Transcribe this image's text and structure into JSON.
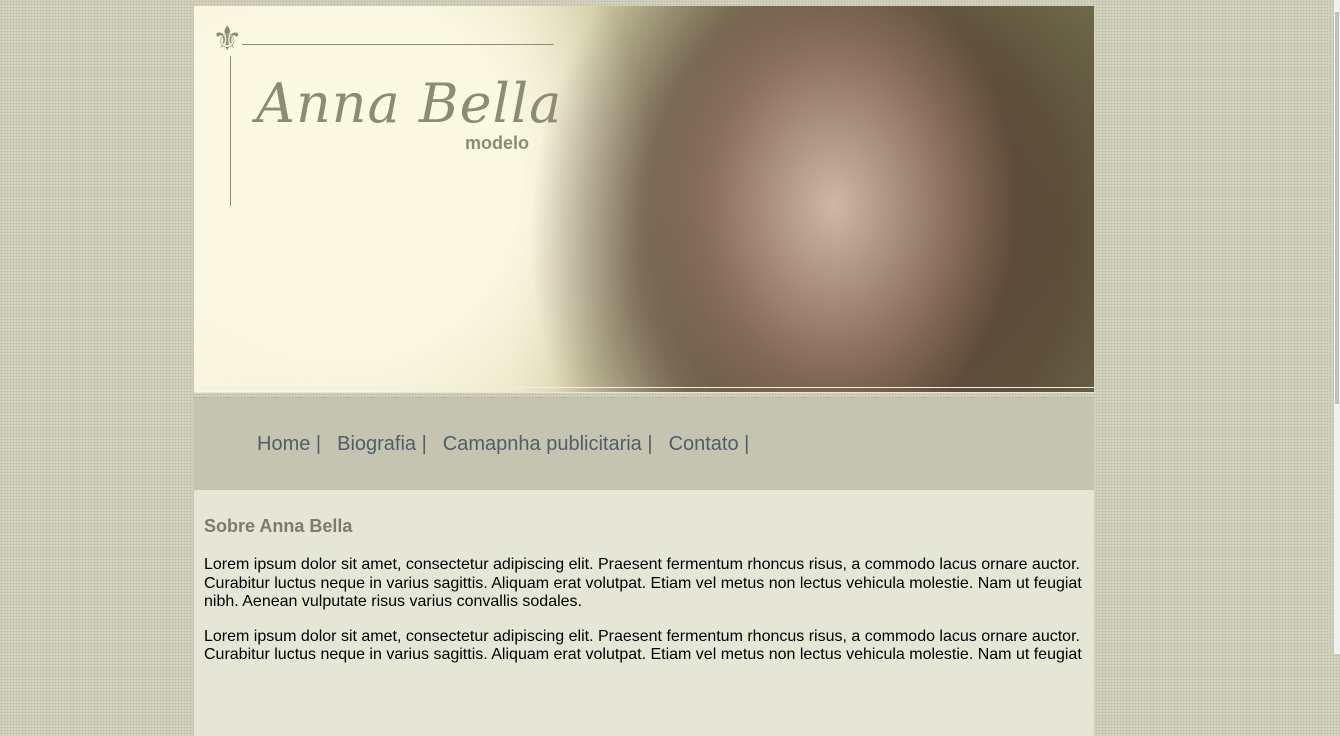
{
  "header": {
    "logo_name": "Anna Bella",
    "logo_subtitle": "modelo",
    "ornament_icon": "fleur-de-lis-icon"
  },
  "nav": {
    "items": [
      {
        "label": "Home |"
      },
      {
        "label": "Biografia |"
      },
      {
        "label": "Camapnha publicitaria |"
      },
      {
        "label": "Contato |"
      }
    ]
  },
  "content": {
    "title": "Sobre Anna Bella",
    "paragraphs": [
      "Lorem ipsum dolor sit amet, consectetur adipiscing elit. Praesent fermentum rhoncus risus, a commodo lacus ornare auctor. Curabitur luctus neque in varius sagittis. Aliquam erat volutpat. Etiam vel metus non lectus vehicula molestie. Nam ut feugiat nibh. Aenean vulputate risus varius convallis sodales.",
      "Lorem ipsum dolor sit amet, consectetur adipiscing elit. Praesent fermentum rhoncus risus, a commodo lacus ornare auctor. Curabitur luctus neque in varius sagittis. Aliquam erat volutpat. Etiam vel metus non lectus vehicula molestie. Nam ut feugiat"
    ]
  },
  "colors": {
    "background": "#d3d3c0",
    "nav_bg": "#c4c4b0",
    "content_bg": "#e6e6d6",
    "nav_text": "#515d6a",
    "heading": "#7c7c6a"
  }
}
